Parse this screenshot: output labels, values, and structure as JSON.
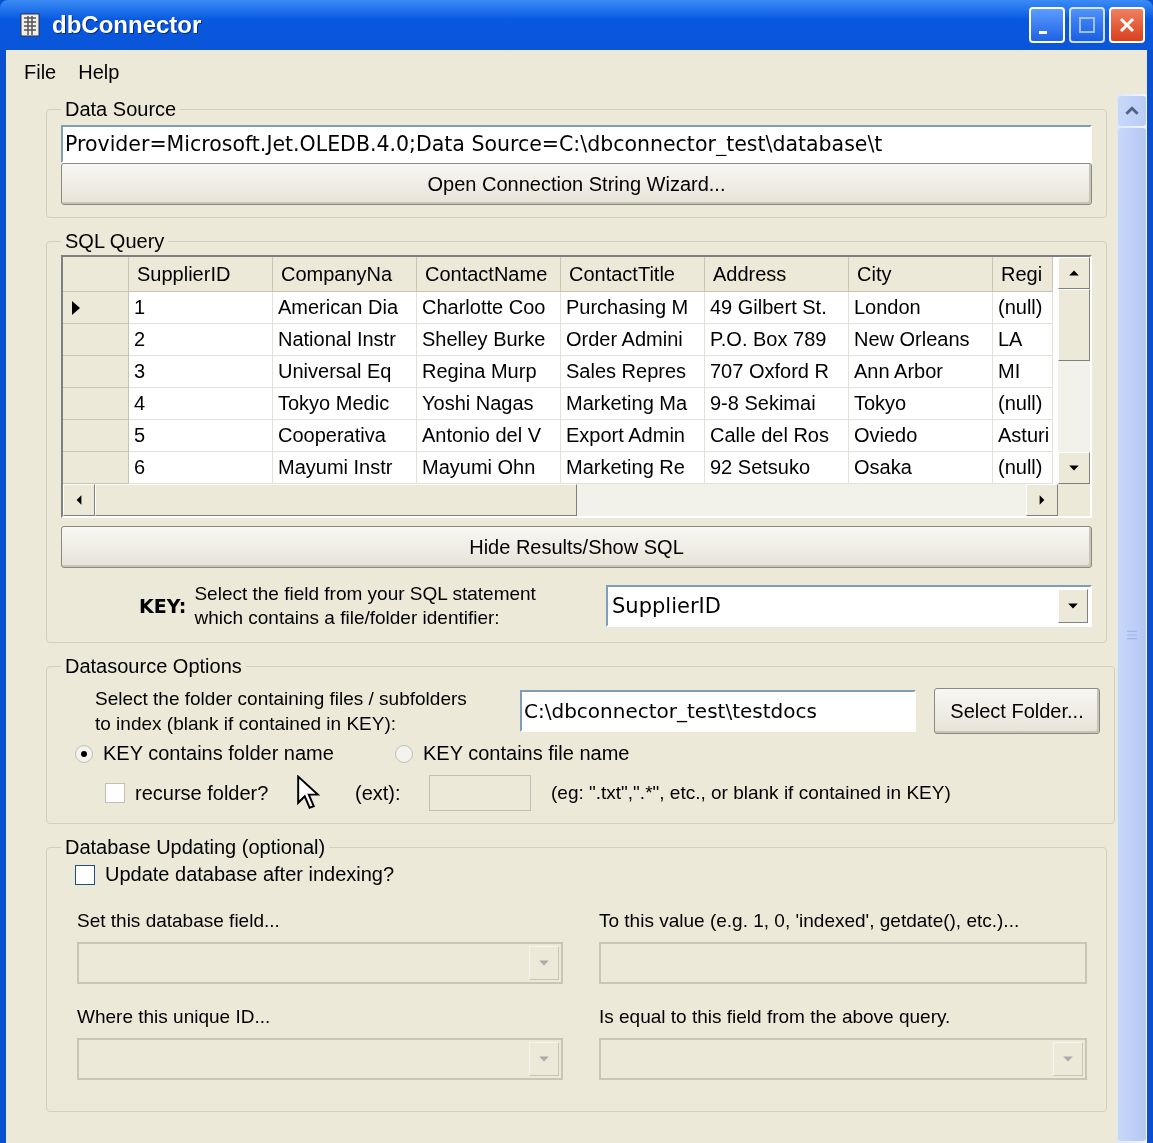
{
  "window": {
    "title": "dbConnector"
  },
  "menu": [
    "File",
    "Help"
  ],
  "data_source": {
    "legend": "Data Source",
    "connection_string": "Provider=Microsoft.Jet.OLEDB.4.0;Data Source=C:\\dbconnector_test\\database\\t",
    "wizard_button": "Open Connection String Wizard..."
  },
  "sql_query": {
    "legend": "SQL Query",
    "columns": [
      "SupplierID",
      "CompanyNa",
      "ContactName",
      "ContactTitle",
      "Address",
      "City",
      "Regi"
    ],
    "rows": [
      {
        "selected": true,
        "cells": [
          "1",
          "American Dia",
          "Charlotte Coo",
          "Purchasing M",
          "49 Gilbert St.",
          "London",
          "(null)"
        ]
      },
      {
        "selected": false,
        "cells": [
          "2",
          "National Instr",
          "Shelley Burke",
          "Order Admini",
          "P.O. Box 789",
          "New Orleans",
          "LA"
        ]
      },
      {
        "selected": false,
        "cells": [
          "3",
          "Universal Eq",
          "Regina Murp",
          "Sales Repres",
          "707 Oxford R",
          "Ann Arbor",
          "MI"
        ]
      },
      {
        "selected": false,
        "cells": [
          "4",
          "Tokyo Medic",
          "Yoshi Nagas",
          "Marketing Ma",
          "9-8 Sekimai",
          "Tokyo",
          "(null)"
        ]
      },
      {
        "selected": false,
        "cells": [
          "5",
          "Cooperativa",
          "Antonio del V",
          "Export Admin",
          "Calle del Ros",
          "Oviedo",
          "Asturi"
        ]
      },
      {
        "selected": false,
        "cells": [
          "6",
          "Mayumi Instr",
          "Mayumi Ohn",
          "Marketing Re",
          "92 Setsuko",
          "Osaka",
          "(null)"
        ]
      }
    ],
    "toggle_button": "Hide Results/Show SQL",
    "key_label": "KEY:",
    "key_hint": "Select the field from your SQL statement\nwhich contains a file/folder identifier:",
    "key_value": "SupplierID"
  },
  "datasource_options": {
    "legend": "Datasource Options",
    "folder_label": "Select the folder containing files / subfolders\nto index (blank if contained in KEY):",
    "folder_value": "C:\\dbconnector_test\\testdocs",
    "select_button": "Select Folder...",
    "modes": [
      {
        "label": "KEY contains folder name",
        "selected": true
      },
      {
        "label": "KEY contains file name",
        "selected": false
      }
    ],
    "recurse": {
      "label": "recurse folder?",
      "checked": false
    },
    "ext_label": "(ext):",
    "ext_hint": "(eg: \".txt\",\".*\", etc., or blank if contained in KEY)"
  },
  "database_updating": {
    "legend": "Database Updating (optional)",
    "update": {
      "label": "Update database after indexing?",
      "checked": false
    },
    "fields": [
      {
        "kind": "dropdown",
        "label": "Set this database field...",
        "disabled": true
      },
      {
        "kind": "text",
        "label": "To this value (e.g. 1, 0, 'indexed', getdate(), etc.)...",
        "disabled": true
      },
      {
        "kind": "dropdown",
        "label": "Where this unique ID...",
        "disabled": true
      },
      {
        "kind": "dropdown",
        "label": "Is equal to this field from the above query.",
        "disabled": true
      }
    ]
  }
}
